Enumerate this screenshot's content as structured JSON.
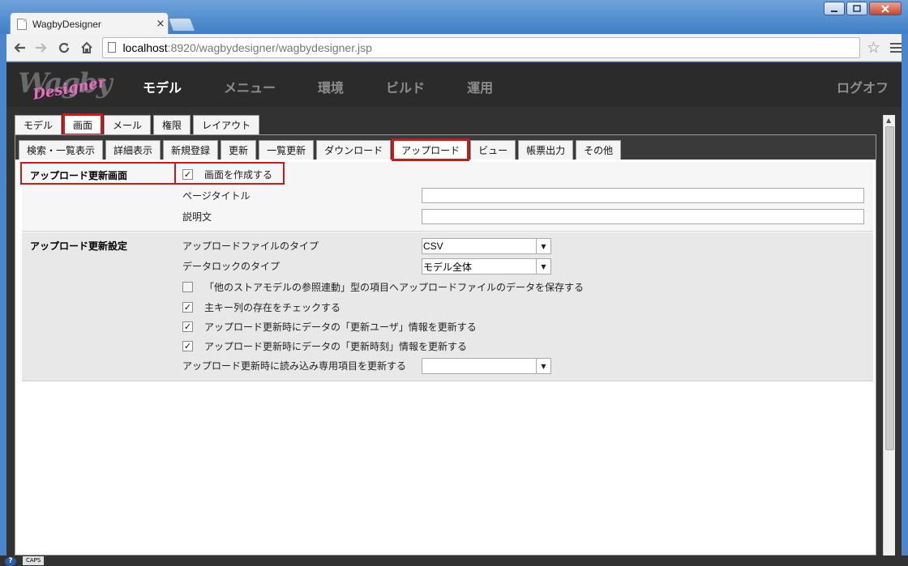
{
  "browser": {
    "tab_title": "WagbyDesigner",
    "tab_close": "×",
    "url_host": "localhost",
    "url_rest": ":8920/wagbydesigner/wagbydesigner.jsp",
    "star": "☆"
  },
  "app": {
    "logo_main": "Wagby",
    "logo_script": "Designer",
    "nav": [
      "モデル",
      "メニュー",
      "環境",
      "ビルド",
      "運用"
    ],
    "logout": "ログオフ"
  },
  "tabs_level1": [
    "モデル",
    "画面",
    "メール",
    "権限",
    "レイアウト"
  ],
  "tabs_level2": [
    "検索・一覧表示",
    "詳細表示",
    "新規登録",
    "更新",
    "一覧更新",
    "ダウンロード",
    "アップロード",
    "ビュー",
    "帳票出力",
    "その他"
  ],
  "section1": {
    "title": "アップロード更新画面",
    "create_screen_label": "画面を作成する",
    "create_screen_checked": true,
    "page_title_label": "ページタイトル",
    "page_title_value": "",
    "description_label": "説明文",
    "description_value": ""
  },
  "section2": {
    "title": "アップロード更新設定",
    "file_type_label": "アップロードファイルのタイプ",
    "file_type_value": "CSV",
    "lock_type_label": "データロックのタイプ",
    "lock_type_value": "モデル全体",
    "options": [
      {
        "label": "「他のストアモデルの参照連動」型の項目へアップロードファイルのデータを保存する",
        "checked": false
      },
      {
        "label": "主キー列の存在をチェックする",
        "checked": true
      },
      {
        "label": "アップロード更新時にデータの「更新ユーザ」情報を更新する",
        "checked": true
      },
      {
        "label": "アップロード更新時にデータの「更新時刻」情報を更新する",
        "checked": true
      }
    ],
    "readonly_update_label": "アップロード更新時に読み込み専用項目を更新する",
    "readonly_update_value": ""
  },
  "status": {
    "caps": "CAPS",
    "help": "?"
  },
  "colors": {
    "highlight": "#cc1a1a",
    "header_bg": "#2b2b2b",
    "nav_active": "#ffffff",
    "nav_inactive": "#8d8d8d"
  },
  "icons": {
    "back": "back-arrow-icon",
    "forward": "forward-arrow-icon",
    "reload": "reload-icon",
    "home": "home-icon",
    "bookmark": "star-icon",
    "menu": "hamburger-menu-icon",
    "checkmark": "✓"
  }
}
